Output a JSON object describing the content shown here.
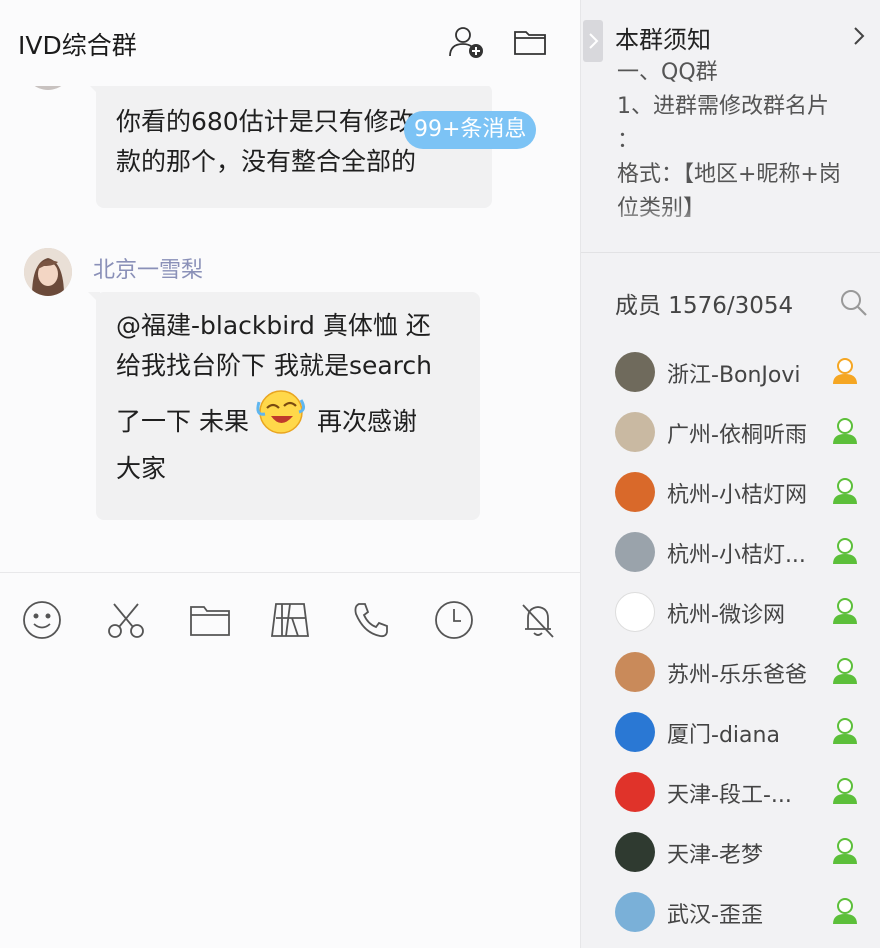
{
  "header": {
    "title": "IVD综合群",
    "add_member_icon": "add-person-icon",
    "files_icon": "folder-icon"
  },
  "messages": {
    "unread_badge": "99+条消息",
    "first": {
      "lines": [
        "你看的680估计是只有修改",
        "款的那个，没有整合全部的"
      ]
    },
    "second": {
      "sender": "北京一雪梨",
      "lines": [
        "@福建-blackbird 真体恤 还",
        "给我找台阶下 我就是search",
        "了一下 未果",
        "再次感谢",
        "大家"
      ],
      "emoji": "laughing-crying-emoji"
    }
  },
  "toolbar": {
    "items": [
      "smiley-icon",
      "scissors-icon",
      "folder-icon",
      "screenshot-icon",
      "phone-icon",
      "clock-icon",
      "bell-off-icon"
    ]
  },
  "side": {
    "notice_title": "本群须知",
    "notice_lines": [
      "一、QQ群",
      "1、进群需修改群名片",
      "：",
      "格式：【地区+昵称+岗",
      "位类别】"
    ],
    "members_label": "成员 1576/3054",
    "members": [
      {
        "name": "浙江-BonJovi",
        "role": "admin",
        "avatar_color": "#6f6a5c"
      },
      {
        "name": "广州-依桐听雨",
        "role": "member",
        "avatar_color": "#c9b9a2"
      },
      {
        "name": "杭州-小桔灯网",
        "role": "member",
        "avatar_color": "#d9692a"
      },
      {
        "name": "杭州-小桔灯...",
        "role": "member",
        "avatar_color": "#9aa3ab"
      },
      {
        "name": "杭州-微诊网",
        "role": "member",
        "avatar_color": "#ffffff"
      },
      {
        "name": "苏州-乐乐爸爸",
        "role": "member",
        "avatar_color": "#c98a5a"
      },
      {
        "name": "厦门-diana",
        "role": "member",
        "avatar_color": "#2a78d4"
      },
      {
        "name": "天津-段工-...",
        "role": "member",
        "avatar_color": "#e0332a"
      },
      {
        "name": "天津-老梦",
        "role": "member",
        "avatar_color": "#2f3a30"
      },
      {
        "name": "武汉-歪歪",
        "role": "member",
        "avatar_color": "#7ab0d8"
      }
    ]
  },
  "colors": {
    "admin_icon": "#f5a623",
    "member_icon": "#5cbf3a",
    "badge": "#7cc3f5",
    "sender_name": "#8a90b8"
  }
}
